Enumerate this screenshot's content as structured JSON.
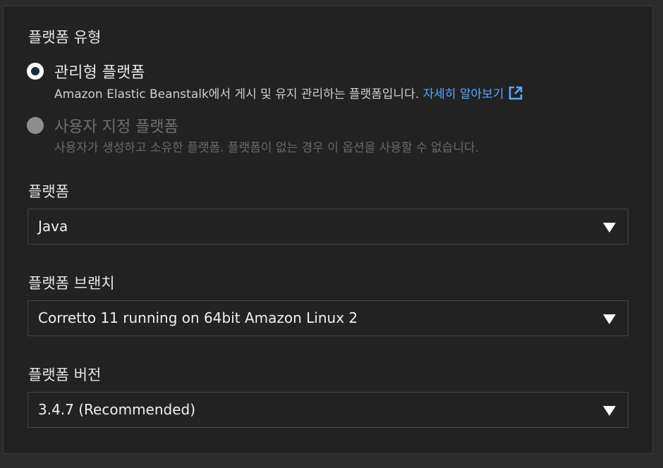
{
  "platform_type": {
    "label": "플랫폼 유형",
    "options": [
      {
        "label": "관리형 플랫폼",
        "selected": true,
        "description": "Amazon Elastic Beanstalk에서 게시 및 유지 관리하는 플랫폼입니다.",
        "link_text": "자세히 알아보기"
      },
      {
        "label": "사용자 지정 플랫폼",
        "selected": false,
        "disabled": true,
        "description": "사용자가 생성하고 소유한 플랫폼. 플랫폼이 없는 경우 이 옵션을 사용할 수 없습니다."
      }
    ]
  },
  "platform": {
    "label": "플랫폼",
    "value": "Java"
  },
  "platform_branch": {
    "label": "플랫폼 브랜치",
    "value": "Corretto 11 running on 64bit Amazon Linux 2"
  },
  "platform_version": {
    "label": "플랫폼 버전",
    "value": "3.4.7 (Recommended)"
  },
  "colors": {
    "background": "#222222",
    "link": "#57a8ff",
    "text": "#e6e6e6",
    "disabled_text": "#6f6f6f"
  }
}
